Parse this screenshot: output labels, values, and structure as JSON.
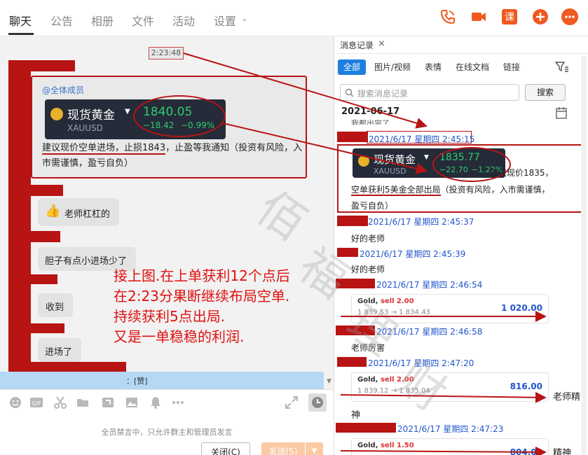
{
  "tabs": [
    "聊天",
    "公告",
    "相册",
    "文件",
    "活动",
    "设置"
  ],
  "top_icons": {
    "course_label": "课"
  },
  "chat": {
    "time": "2:23:48",
    "at_all": "@全体成员",
    "gold": {
      "name": "现货黄金",
      "code": "XAUUSD",
      "price": "1840.05",
      "change": "−18.42",
      "pct": "−0.99%"
    },
    "msg_parts": [
      "建议现价空单进场，",
      "止损1843",
      "，止盈等我通知（投资有风险，入市需谨慎，盈亏自负）"
    ],
    "replies": [
      {
        "text": "老师杠杠的",
        "emoji": "👍"
      },
      {
        "text": "胆子有点小进场少了"
      },
      {
        "text": "收到"
      },
      {
        "text": "进场了"
      }
    ],
    "overlay_lines": [
      "接上图.在上单获利12个点后",
      "在2:23分果断继续布局空单.",
      "持续获利5点出局.",
      "又是一单稳稳的利润."
    ],
    "last_msg": "：[赞]",
    "muted": "全员禁言中，只允许群主和管理员发言",
    "close_btn": "关闭(C)",
    "send_btn": "发送(S)"
  },
  "side": {
    "title": "消息记录",
    "filters": [
      "全部",
      "图片/视频",
      "表情",
      "在线文档",
      "链接"
    ],
    "search_placeholder": "搜索消息记录",
    "search_btn": "搜索",
    "date": "2021-06-17",
    "partial": "我都出完了",
    "rec1": {
      "time": "2021/6/17 星期四 2:45:15",
      "gold": {
        "name": "现货黄金",
        "code": "XAUUSD",
        "price": "1835.77",
        "change": "−22.70",
        "pct": "−1.22%"
      },
      "text_a": "建议现价1835，",
      "text_b1": "空单获利5美金全部出局",
      "text_b2": "（投资有风险，入市需谨慎，",
      "text_c": "盈亏自负）"
    },
    "rec2": {
      "time": "2021/6/17 星期四 2:45:37",
      "text": "好的老师"
    },
    "rec3": {
      "time": "2021/6/17 星期四 2:45:39",
      "text": "好的老师"
    },
    "rec4": {
      "time": "2021/6/17 星期四 2:46:54",
      "trade": {
        "title": "Gold,",
        "side": "sell 2.00",
        "detail": "1 839.53 → 1 834.43",
        "amount": "1 020.00"
      }
    },
    "rec5": {
      "time": "2021/6/17 星期四 2:46:58",
      "text": "老师厉害"
    },
    "rec6": {
      "time": "2021/6/17 星期四 2:47:20",
      "trade": {
        "title": "Gold,",
        "side": "sell 2.00",
        "detail": "1 839.12 → 1 835.04",
        "amount": "816.00"
      },
      "text_a": "老师精",
      "text_b": "神"
    },
    "rec7": {
      "time": "2021/6/17 星期四 2:47:23",
      "trade": {
        "title": "Gold,",
        "side": "sell 1.50",
        "amount": "804.00"
      },
      "text": "精神"
    }
  },
  "watermark": [
    "佰",
    "福",
    "理",
    "财"
  ],
  "colors": {
    "accent": "#1e7fe0",
    "icon_orange": "#f0591f",
    "annotation_red": "#b81414",
    "overlay_red": "#e01010"
  }
}
